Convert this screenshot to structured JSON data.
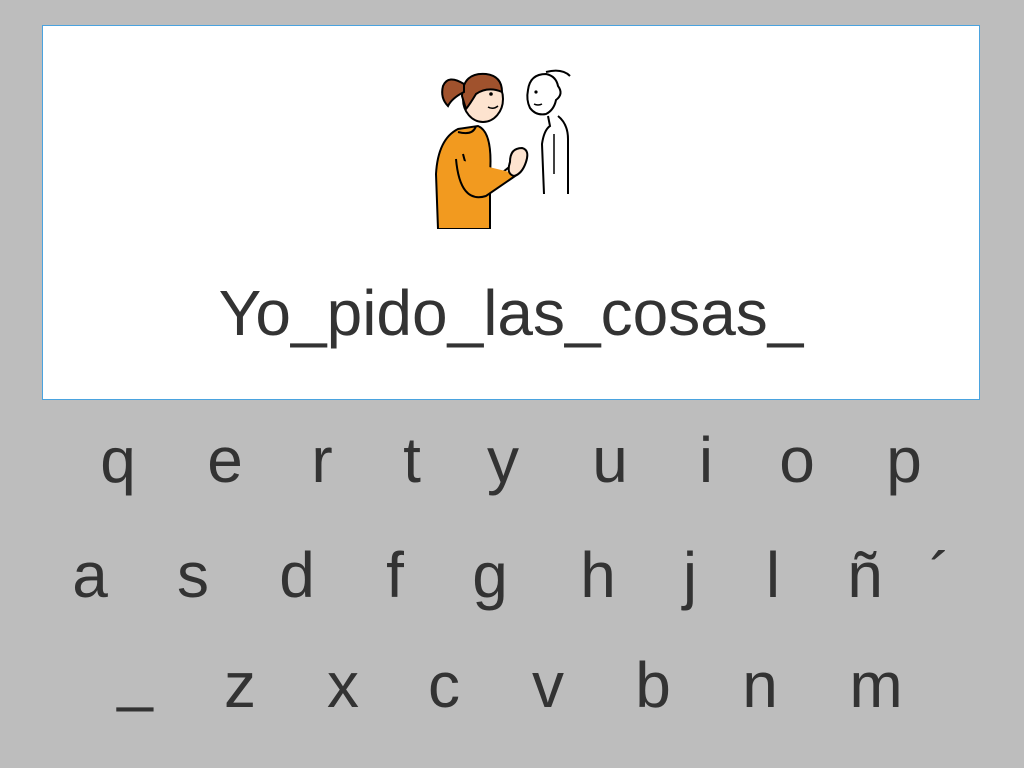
{
  "display": {
    "typed_text": "Yo_pido_las_cosas_",
    "pictogram": "person-asking-icon"
  },
  "keyboard": {
    "row1": [
      "q",
      "e",
      "r",
      "t",
      "y",
      "u",
      "i",
      "o",
      "p"
    ],
    "row2": [
      "a",
      "s",
      "d",
      "f",
      "g",
      "h",
      "j",
      "l",
      "ñ",
      "´"
    ],
    "row3": [
      "_",
      "z",
      "x",
      "c",
      "v",
      "b",
      "n",
      "m"
    ]
  },
  "colors": {
    "background": "#bdbdbd",
    "panel": "#ffffff",
    "panel_border": "#4aa3df",
    "text": "#333333",
    "shirt": "#f29a1f",
    "hair": "#a0522d"
  }
}
